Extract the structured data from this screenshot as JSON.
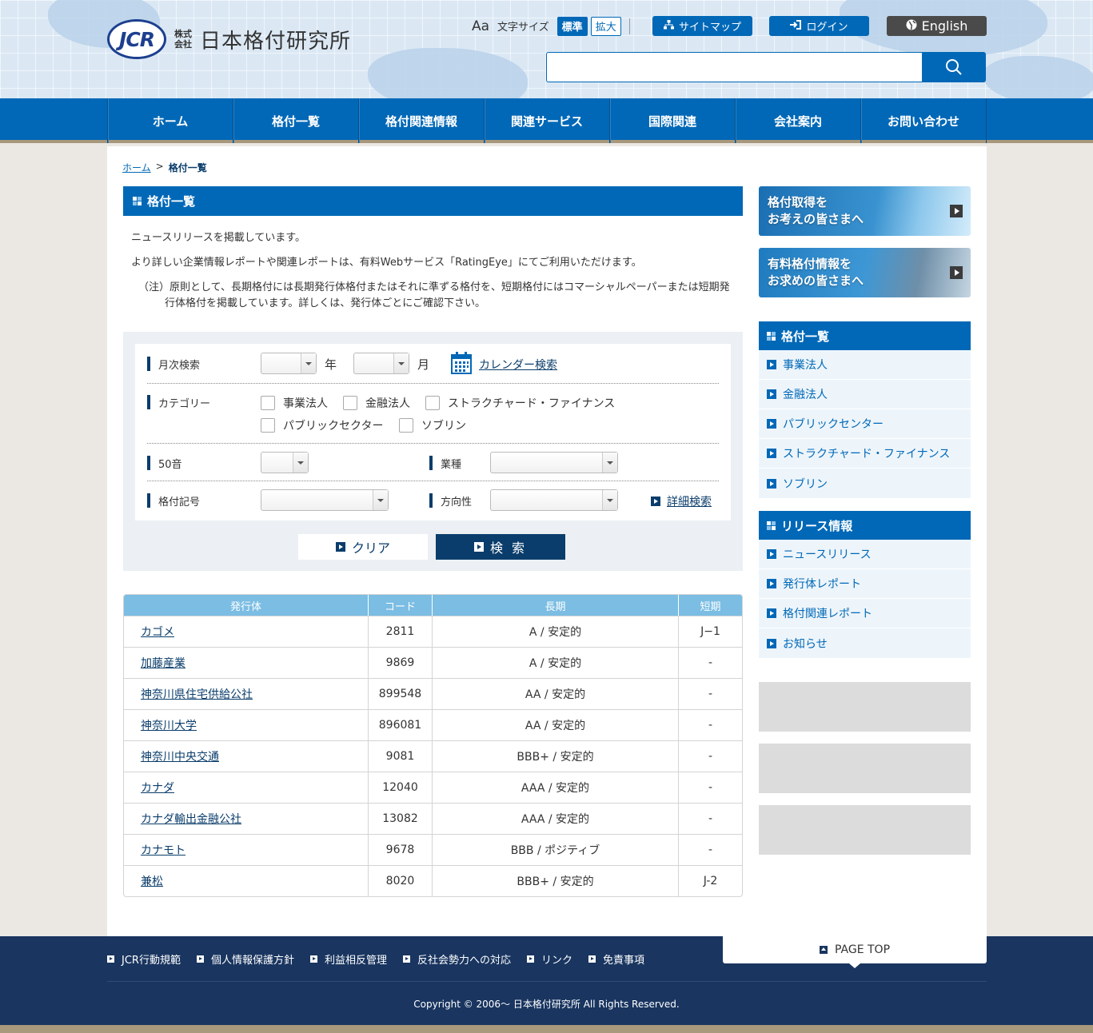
{
  "header": {
    "logo_mark": "JCR",
    "logo_kabushiki": "株式会社",
    "logo_name": "日本格付研究所",
    "font_size_icon": "Aa",
    "font_size_label": "文字サイズ",
    "font_standard": "標準",
    "font_large": "拡大",
    "sitemap": "サイトマップ",
    "login": "ログイン",
    "english": "English",
    "search_placeholder": ""
  },
  "nav": [
    "ホーム",
    "格付一覧",
    "格付関連情報",
    "関連サービス",
    "国際関連",
    "会社案内",
    "お問い合わせ"
  ],
  "breadcrumb": {
    "home": "ホーム",
    "sep": ">",
    "current": "格付一覧"
  },
  "main": {
    "title": "格付一覧",
    "intro1": "ニュースリリースを掲載しています。",
    "intro2": "より詳しい企業情報レポートや関連レポートは、有料Webサービス「RatingEye」にてご利用いただけます。",
    "note": "（注）原則として、長期格付には長期発行体格付またはそれに準ずる格付を、短期格付にはコマーシャルペーパーまたは短期発行体格付を掲載しています。詳しくは、発行体ごとにご確認下さい。"
  },
  "search": {
    "monthly_label": "月次検索",
    "year_suffix": "年",
    "month_suffix": "月",
    "calendar_link": "カレンダー検索",
    "category_label": "カテゴリー",
    "categories": [
      "事業法人",
      "金融法人",
      "ストラクチャード・ファイナンス",
      "パブリックセクター",
      "ソブリン"
    ],
    "kana_label": "50音",
    "industry_label": "業種",
    "rating_label": "格付記号",
    "direction_label": "方向性",
    "detail_link": "詳細検索",
    "clear_button": "クリア",
    "search_button": "検 索"
  },
  "table": {
    "headers": [
      "発行体",
      "コード",
      "長期",
      "短期"
    ],
    "rows": [
      [
        "カゴメ",
        "2811",
        "A / 安定的",
        "J−1"
      ],
      [
        "加藤産業",
        "9869",
        "A / 安定的",
        "-"
      ],
      [
        "神奈川県住宅供給公社",
        "899548",
        "AA / 安定的",
        "-"
      ],
      [
        "神奈川大学",
        "896081",
        "AA / 安定的",
        "-"
      ],
      [
        "神奈川中央交通",
        "9081",
        "BBB+ / 安定的",
        "-"
      ],
      [
        "カナダ",
        "12040",
        "AAA / 安定的",
        "-"
      ],
      [
        "カナダ輸出金融公社",
        "13082",
        "AAA / 安定的",
        "-"
      ],
      [
        "カナモト",
        "9678",
        "BBB / ポジティブ",
        "-"
      ],
      [
        "兼松",
        "8020",
        "BBB+ / 安定的",
        "J-2"
      ]
    ]
  },
  "sidebar": {
    "banner1": [
      "格付取得を",
      "お考えの皆さまへ"
    ],
    "banner2": [
      "有料格付情報を",
      "お求めの皆さまへ"
    ],
    "list1_title": "格付一覧",
    "list1": [
      "事業法人",
      "金融法人",
      "パブリックセンター",
      "ストラクチャード・ファイナンス",
      "ソブリン"
    ],
    "list2_title": "リリース情報",
    "list2": [
      "ニュースリリース",
      "発行体レポート",
      "格付関連レポート",
      "お知らせ"
    ]
  },
  "footer": {
    "links": [
      "JCR行動規範",
      "個人情報保護方針",
      "利益相反管理",
      "反社会勢力への対応",
      "リンク",
      "免責事項"
    ],
    "page_top": "PAGE TOP",
    "copyright": "Copyright © 2006〜 日本格付研究所 All Rights Reserved."
  },
  "colors": {
    "primary": "#0068b7",
    "navy": "#0a3d6b",
    "footer": "#193560",
    "accent_bar": "#a8987c"
  }
}
